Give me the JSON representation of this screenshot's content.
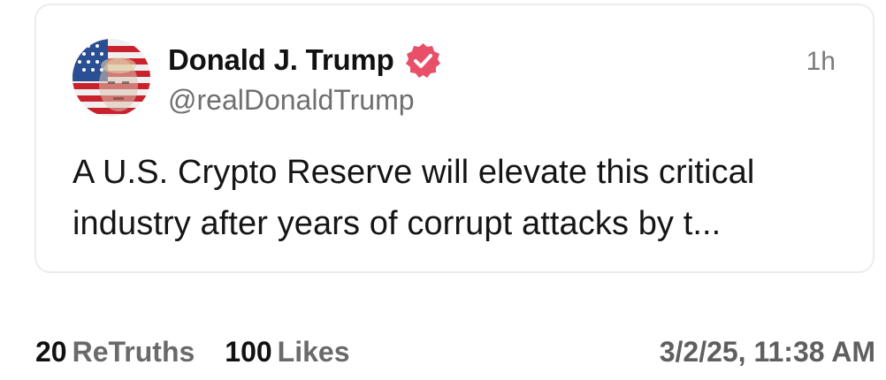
{
  "post": {
    "author_name": "Donald J. Trump",
    "handle": "@realDonaldTrump",
    "time_ago": "1h",
    "text_line1": "A U.S. Crypto Reserve will elevate this critical",
    "text_line2": "industry after years of corrupt attacks by t...",
    "avatar_icon": "flag-portrait-avatar",
    "verified_icon": "verified-badge-icon",
    "verified_color": "#e8506a"
  },
  "stats": {
    "retruths_count": "20",
    "retruths_label": "ReTruths",
    "likes_count": "100",
    "likes_label": "Likes",
    "timestamp": "3/2/25, 11:38 AM"
  }
}
